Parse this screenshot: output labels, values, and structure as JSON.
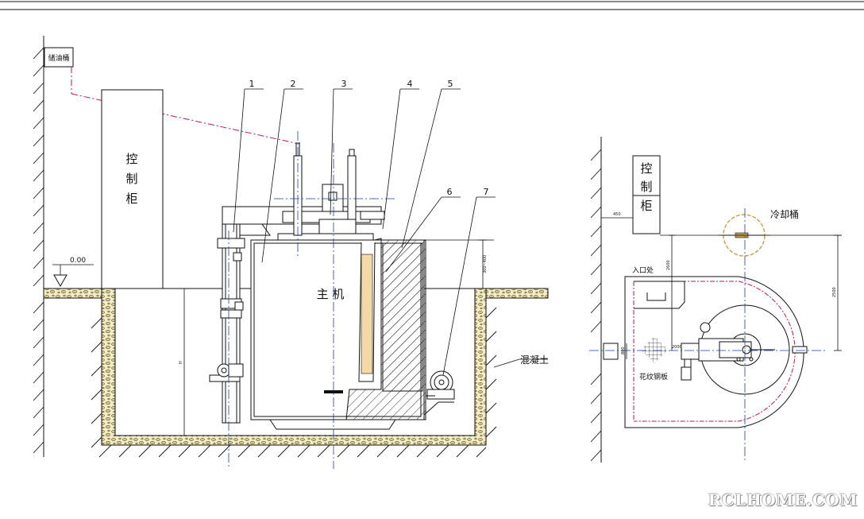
{
  "labels": {
    "oil_tank": "储油桶",
    "control_cabinet_left": [
      "控",
      "制",
      "柜"
    ],
    "control_cabinet_right": [
      "控",
      "制",
      "柜"
    ],
    "main_unit": "主  机",
    "concrete": "混凝土",
    "cooling_tank": "冷却桶",
    "entrance": "入口处",
    "checker_plate": "花纹钢板",
    "level_mark": "0.00"
  },
  "part_numbers": [
    "1",
    "2",
    "3",
    "4",
    "5",
    "6",
    "7"
  ],
  "dimensions": {
    "depth_left": "H",
    "height_right_of_main": "300~400",
    "right_view_wall_gap": "450",
    "right_view_vertical": "2500",
    "right_view_short": "2600",
    "right_view_entry": "800",
    "right_view_small": "2000"
  },
  "watermark": "RCLHOME.COM",
  "colors": {
    "line": "#111111",
    "dashdot_red": "#c0145a",
    "hatch": "#333333",
    "aggregate": "#d9c87a",
    "centerline": "#1a3fa0"
  }
}
